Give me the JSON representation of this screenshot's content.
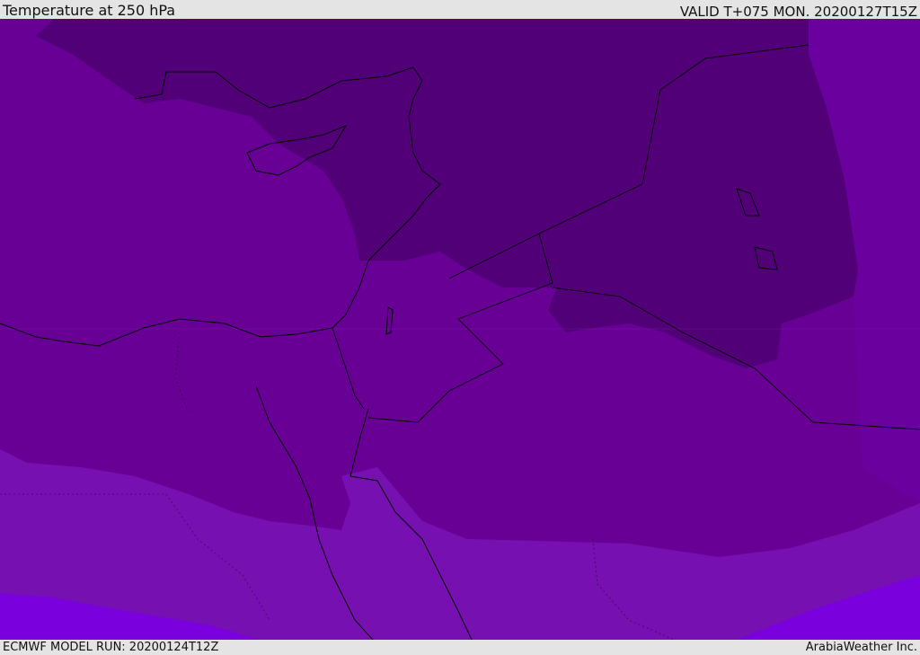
{
  "header": {
    "title": "Temperature at 250 hPa",
    "valid": "VALID T+075 MON. 20200127T15Z"
  },
  "footer": {
    "model_run": "ECMWF MODEL RUN: 20200124T12Z",
    "credit": "ArabiaWeather Inc."
  },
  "map": {
    "field": "temperature",
    "level": "250 hPa",
    "region": "Eastern Mediterranean / Middle East",
    "colors": {
      "band_darkest": "#520078",
      "band_dark": "#5f0094",
      "band_mid": "#680096",
      "band_light": "#7610b0",
      "band_lightest": "#7a00dd",
      "coastline": "#000000"
    }
  }
}
